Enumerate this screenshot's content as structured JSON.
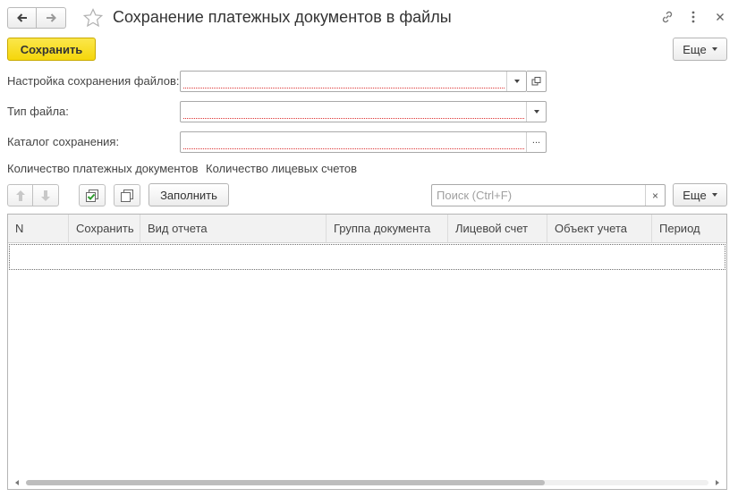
{
  "window": {
    "title": "Сохранение платежных документов в файлы",
    "icons": [
      "link-icon",
      "more-vertical-icon",
      "close-icon"
    ]
  },
  "commandbar": {
    "save_label": "Сохранить",
    "more_label": "Еще"
  },
  "form": {
    "settings": {
      "label": "Настройка сохранения файлов:",
      "value": ""
    },
    "file_type": {
      "label": "Тип файла:",
      "value": ""
    },
    "catalog": {
      "label": "Каталог сохранения:",
      "value": "",
      "choose_glyph": "..."
    }
  },
  "counts": {
    "payment_docs": "Количество платежных документов",
    "accounts": "Количество лицевых счетов"
  },
  "table_toolbar": {
    "fill_label": "Заполнить",
    "search_placeholder": "Поиск (Ctrl+F)",
    "clear_glyph": "×",
    "more_label": "Еще"
  },
  "table": {
    "columns": [
      "N",
      "Сохранить",
      "Вид отчета",
      "Группа документа",
      "Лицевой счет",
      "Объект учета",
      "Период"
    ],
    "rows": []
  },
  "colors": {
    "primary_button": "#f5d60b",
    "required_underline": "#dd3333"
  }
}
